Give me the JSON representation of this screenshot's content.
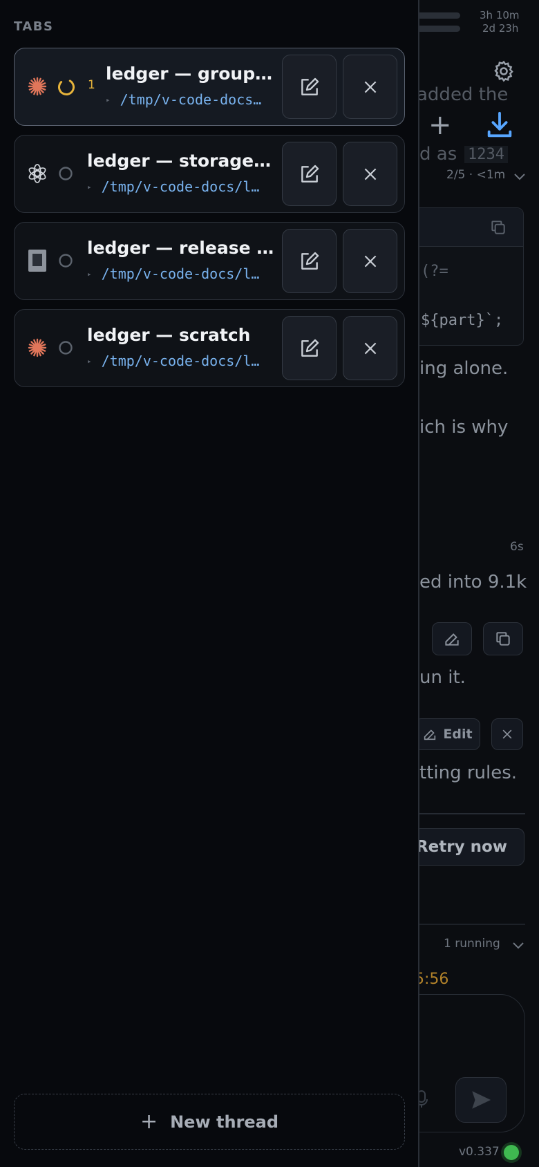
{
  "background": {
    "timers": [
      "3h 10m",
      "2d 23h"
    ],
    "text_fragments": {
      "added_the": "added the",
      "d_as": "d as",
      "code_1234": "1234",
      "progress": "2/5 · <1m",
      "code_lookahead": "(?=",
      "code_part": "${part}`;",
      "ing_alone": "ing alone.",
      "ich_is_why": "ich is why",
      "elapsed": "6s",
      "ed_into": "ed into 9.1k",
      "un_it": "un it.",
      "edit_label": "Edit",
      "tting_rules": "tting rules.",
      "retry_now": "Retry now",
      "running": "1 running",
      "clock": "5:56",
      "version": "v0.337"
    },
    "colors": {
      "accent_blue": "#58a6ff",
      "status_green": "#3fb950",
      "clock_orange": "#d29922"
    }
  },
  "drawer": {
    "title": "TABS",
    "tabs": [
      {
        "title": "ledger — groupin…",
        "path": "/tmp/v-code-docs…",
        "agent": "claude-asterisk-icon",
        "status": "running-spinner-icon",
        "badge": "1",
        "active": true
      },
      {
        "title": "ledger — storage re…",
        "path": "/tmp/v-code-docs/l…",
        "agent": "openai-knot-icon",
        "status": "idle-circle-icon",
        "badge": "",
        "active": false
      },
      {
        "title": "ledger — release not…",
        "path": "/tmp/v-code-docs/l…",
        "agent": "terminal-block-icon",
        "status": "idle-circle-icon",
        "badge": "",
        "active": false
      },
      {
        "title": "ledger — scratch",
        "path": "/tmp/v-code-docs/l…",
        "agent": "claude-asterisk-icon",
        "status": "idle-circle-icon",
        "badge": "",
        "active": false
      }
    ],
    "new_thread_label": "New thread",
    "new_thread_icon": "+",
    "path_arrow": "▸"
  }
}
